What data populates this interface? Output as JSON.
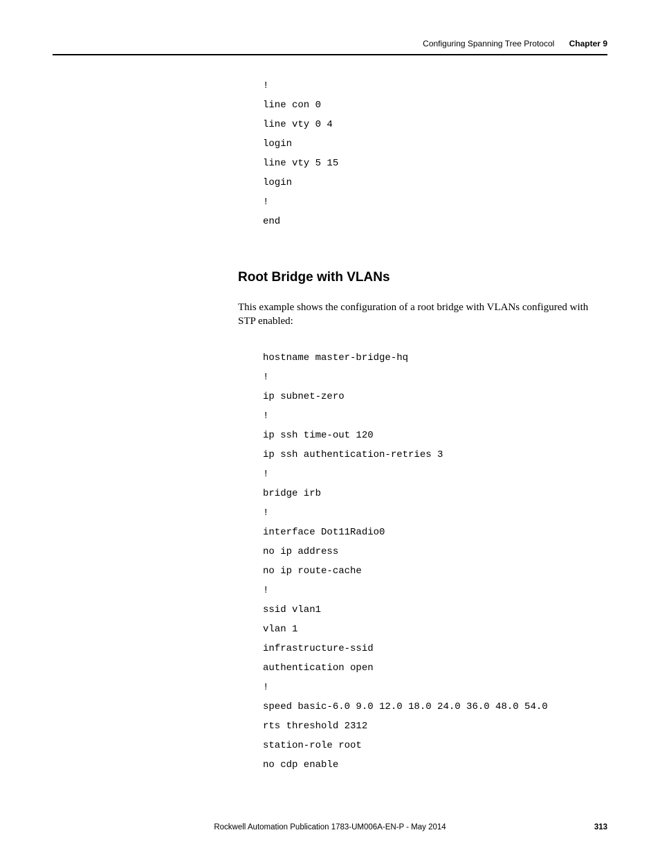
{
  "header": {
    "section": "Configuring Spanning Tree Protocol",
    "chapter": "Chapter 9"
  },
  "code1": "!\nline con 0\nline vty 0 4\nlogin\nline vty 5 15\nlogin\n!\nend",
  "subheading": "Root Bridge with VLANs",
  "paragraph": "This example shows the configuration of a root bridge with VLANs configured with STP enabled:",
  "code2": "hostname master-bridge-hq\n!\nip subnet-zero\n!\nip ssh time-out 120\nip ssh authentication-retries 3\n!\nbridge irb\n!\ninterface Dot11Radio0\nno ip address\nno ip route-cache\n!\nssid vlan1\nvlan 1\ninfrastructure-ssid\nauthentication open\n!\nspeed basic-6.0 9.0 12.0 18.0 24.0 36.0 48.0 54.0\nrts threshold 2312\nstation-role root\nno cdp enable",
  "footer": {
    "publication": "Rockwell Automation Publication 1783-UM006A-EN-P - May 2014",
    "page": "313"
  }
}
